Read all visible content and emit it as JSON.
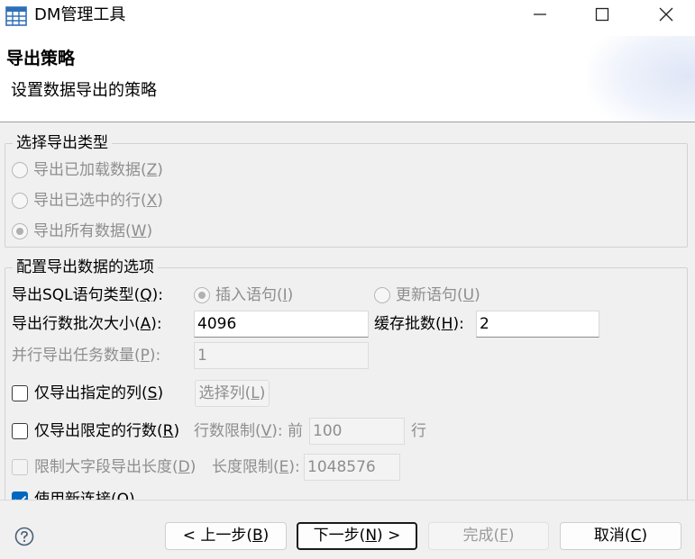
{
  "window": {
    "title": "DM管理工具",
    "icon": "table-grid-icon"
  },
  "header": {
    "title": "导出策略",
    "description": "设置数据导出的策略"
  },
  "export_type": {
    "legend": "选择导出类型",
    "options": [
      {
        "label": "导出已加载数据(",
        "mnemonic": "Z",
        "suffix": ")",
        "checked": false
      },
      {
        "label": "导出已选中的行(",
        "mnemonic": "X",
        "suffix": ")",
        "checked": false
      },
      {
        "label": "导出所有数据(",
        "mnemonic": "W",
        "suffix": ")",
        "checked": true
      }
    ]
  },
  "config": {
    "legend": "配置导出数据的选项",
    "sql_type": {
      "label": "导出SQL语句类型(",
      "mnemonic": "Q",
      "suffix": "):",
      "insert": {
        "label": "插入语句(",
        "mnemonic": "I",
        "suffix": ")",
        "checked": true
      },
      "update": {
        "label": "更新语句(",
        "mnemonic": "U",
        "suffix": ")",
        "checked": false
      }
    },
    "batch_size": {
      "label": "导出行数批次大小(",
      "mnemonic": "A",
      "suffix": "):",
      "value": "4096"
    },
    "cache_batch": {
      "label": "缓存批数(",
      "mnemonic": "H",
      "suffix": "):",
      "value": "2"
    },
    "parallel": {
      "label": "并行导出任务数量(",
      "mnemonic": "P",
      "suffix": "):",
      "value": "1"
    },
    "only_columns": {
      "label": "仅导出指定的列(",
      "mnemonic": "S",
      "suffix": ")",
      "checked": false,
      "button": {
        "label": "选择列(",
        "mnemonic": "L",
        "suffix": ")"
      }
    },
    "only_rows": {
      "label": "仅导出限定的行数(",
      "mnemonic": "R",
      "suffix": ")",
      "checked": false,
      "limit_label": "行数限制(",
      "limit_mnemonic": "V",
      "limit_suffix": "): 前",
      "limit_value": "100",
      "unit": "行"
    },
    "limit_lob": {
      "label": "限制大字段导出长度(",
      "mnemonic": "D",
      "suffix": ")",
      "checked": false,
      "limit_label": "长度限制(",
      "limit_mnemonic": "E",
      "limit_suffix": "):",
      "limit_value": "1048576"
    },
    "new_connection": {
      "label": "使用新连接(",
      "mnemonic": "O",
      "suffix": ")",
      "checked": true
    }
  },
  "footer": {
    "help_icon": "question-circle-icon",
    "back": {
      "label": "< 上一步(",
      "mnemonic": "B",
      "suffix": ")"
    },
    "next": {
      "label": "下一步(",
      "mnemonic": "N",
      "suffix": ") >"
    },
    "finish": {
      "label": "完成(",
      "mnemonic": "F",
      "suffix": ")"
    },
    "cancel": {
      "label": "取消(",
      "mnemonic": "C",
      "suffix": ")"
    }
  }
}
